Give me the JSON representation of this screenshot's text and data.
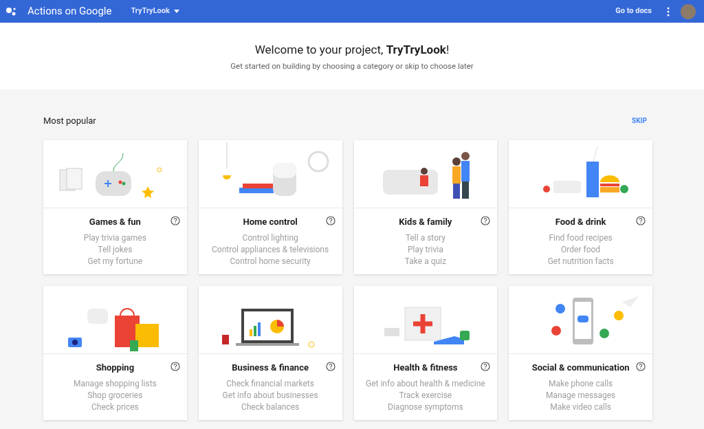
{
  "header": {
    "app_title": "Actions on Google",
    "project": "TryTryLook",
    "docs_link": "Go to docs"
  },
  "welcome": {
    "title": "Welcome to your project, **TryTryLook**!",
    "subtitle": "Get started on building by choosing a category or skip to choose later"
  },
  "section": {
    "title": "Most popular",
    "skip": "SKIP"
  },
  "categories": [
    {
      "title": "Games & fun",
      "examples": [
        "Play trivia games",
        "Tell jokes",
        "Get my fortune"
      ]
    },
    {
      "title": "Home control",
      "examples": [
        "Control lighting",
        "Control appliances & televisions",
        "Control home security"
      ]
    },
    {
      "title": "Kids & family",
      "examples": [
        "Tell a story",
        "Play trivia",
        "Take a quiz"
      ]
    },
    {
      "title": "Food & drink",
      "examples": [
        "Find food recipes",
        "Order food",
        "Get nutrition facts"
      ]
    },
    {
      "title": "Shopping",
      "examples": [
        "Manage shopping lists",
        "Shop groceries",
        "Check prices"
      ]
    },
    {
      "title": "Business & finance",
      "examples": [
        "Check financial markets",
        "Get info about businesses",
        "Check balances"
      ]
    },
    {
      "title": "Health & fitness",
      "examples": [
        "Get info about health & medicine",
        "Track exercise",
        "Diagnose symptoms"
      ]
    },
    {
      "title": "Social & communication",
      "examples": [
        "Make phone calls",
        "Manage messages",
        "Make video calls"
      ]
    }
  ]
}
